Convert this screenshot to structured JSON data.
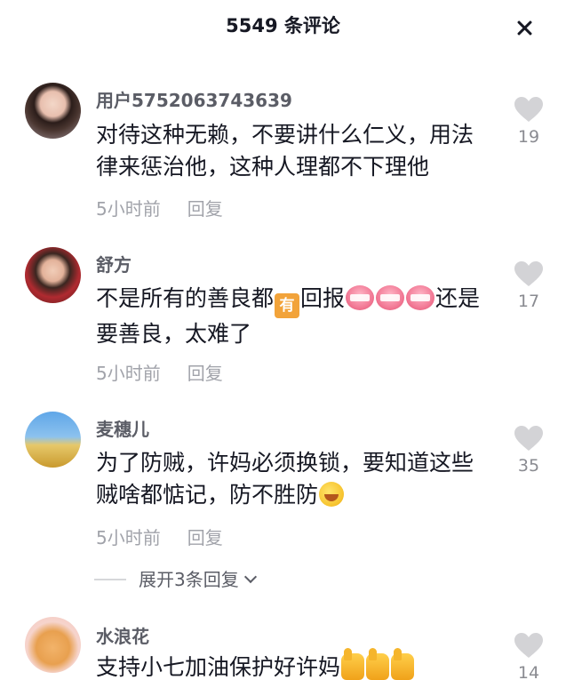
{
  "header": {
    "title": "5549 条评论"
  },
  "comments": [
    {
      "username": "用户5752063743639",
      "text": "对待这种无赖，不要讲什么仁义，用法律来惩治他，这种人理都不下理他",
      "time": "5小时前",
      "reply": "回复",
      "likes": "19"
    },
    {
      "username": "舒方",
      "text_a": "不是所有的善良都",
      "emoji_you": "有",
      "text_b": "回报",
      "text_c": "还是要善良，太难了",
      "time": "5小时前",
      "reply": "回复",
      "likes": "17"
    },
    {
      "username": "麦穗儿",
      "text": "为了防贼，许妈必须换锁，要知道这些贼啥都惦记，防不胜防",
      "time": "5小时前",
      "reply": "回复",
      "likes": "35"
    },
    {
      "username": "水浪花",
      "text": "支持小七加油保护好许妈",
      "likes": "14"
    }
  ],
  "expand_replies": "展开3条回复",
  "icons": {
    "close": "close-icon",
    "like": "heart-icon",
    "expand": "chevron-down-icon"
  },
  "colors": {
    "text": "#161823",
    "username": "#5b5d66",
    "meta": "#a1a3aa",
    "heart": "#d3d3d6"
  }
}
